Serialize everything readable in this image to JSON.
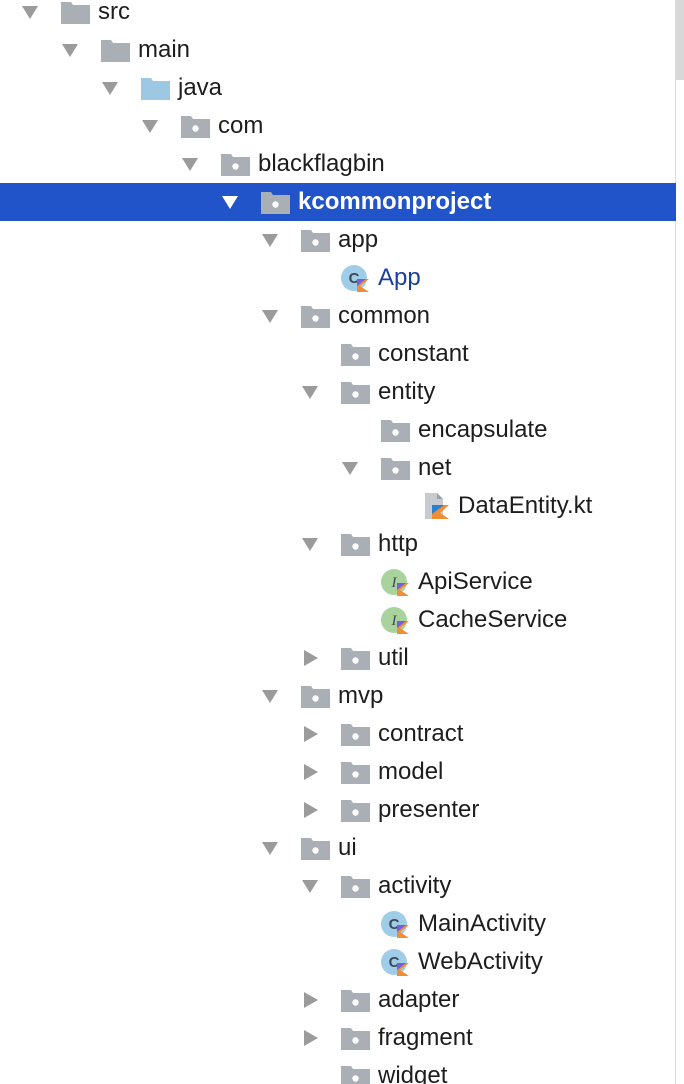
{
  "tree": [
    {
      "label": "src",
      "depth": 0,
      "expanded": true,
      "icon": "folder-gray-icon"
    },
    {
      "label": "main",
      "depth": 1,
      "expanded": true,
      "icon": "folder-gray-icon"
    },
    {
      "label": "java",
      "depth": 2,
      "expanded": true,
      "icon": "folder-blue-source-icon"
    },
    {
      "label": "com",
      "depth": 3,
      "expanded": true,
      "icon": "package-folder-icon"
    },
    {
      "label": "blackflagbin",
      "depth": 4,
      "expanded": true,
      "icon": "package-folder-icon"
    },
    {
      "label": "kcommonproject",
      "depth": 5,
      "expanded": true,
      "icon": "package-folder-icon",
      "selected": true
    },
    {
      "label": "app",
      "depth": 6,
      "expanded": true,
      "icon": "package-folder-icon"
    },
    {
      "label": "App",
      "depth": 7,
      "icon": "kotlin-class-icon",
      "kind": "kotlin-class"
    },
    {
      "label": "common",
      "depth": 6,
      "expanded": true,
      "icon": "package-folder-icon"
    },
    {
      "label": "constant",
      "depth": 7,
      "icon": "package-folder-icon"
    },
    {
      "label": "entity",
      "depth": 7,
      "expanded": true,
      "icon": "package-folder-icon"
    },
    {
      "label": "encapsulate",
      "depth": 8,
      "icon": "package-folder-icon"
    },
    {
      "label": "net",
      "depth": 8,
      "expanded": true,
      "icon": "package-folder-icon"
    },
    {
      "label": "DataEntity.kt",
      "depth": 9,
      "icon": "kotlin-file-icon"
    },
    {
      "label": "http",
      "depth": 7,
      "expanded": true,
      "icon": "package-folder-icon"
    },
    {
      "label": "ApiService",
      "depth": 8,
      "icon": "kotlin-interface-icon"
    },
    {
      "label": "CacheService",
      "depth": 8,
      "icon": "kotlin-interface-icon"
    },
    {
      "label": "util",
      "depth": 7,
      "expanded": false,
      "icon": "package-folder-icon"
    },
    {
      "label": "mvp",
      "depth": 6,
      "expanded": true,
      "icon": "package-folder-icon"
    },
    {
      "label": "contract",
      "depth": 7,
      "expanded": false,
      "icon": "package-folder-icon"
    },
    {
      "label": "model",
      "depth": 7,
      "expanded": false,
      "icon": "package-folder-icon"
    },
    {
      "label": "presenter",
      "depth": 7,
      "expanded": false,
      "icon": "package-folder-icon"
    },
    {
      "label": "ui",
      "depth": 6,
      "expanded": true,
      "icon": "package-folder-icon"
    },
    {
      "label": "activity",
      "depth": 7,
      "expanded": true,
      "icon": "package-folder-icon"
    },
    {
      "label": "MainActivity",
      "depth": 8,
      "icon": "kotlin-class-icon"
    },
    {
      "label": "WebActivity",
      "depth": 8,
      "icon": "kotlin-class-icon"
    },
    {
      "label": "adapter",
      "depth": 7,
      "expanded": false,
      "icon": "package-folder-icon"
    },
    {
      "label": "fragment",
      "depth": 7,
      "expanded": false,
      "icon": "package-folder-icon"
    },
    {
      "label": "widget",
      "depth": 7,
      "icon": "package-folder-icon"
    }
  ],
  "colors": {
    "selection": "#2154c9",
    "folder": "#aab0b6",
    "source_folder": "#9dc8e4",
    "arrow": "#9b9b9b",
    "kotlin_class_label": "#1b3fa0",
    "class_badge": "#9fcde8",
    "interface_badge": "#a9d39c"
  }
}
